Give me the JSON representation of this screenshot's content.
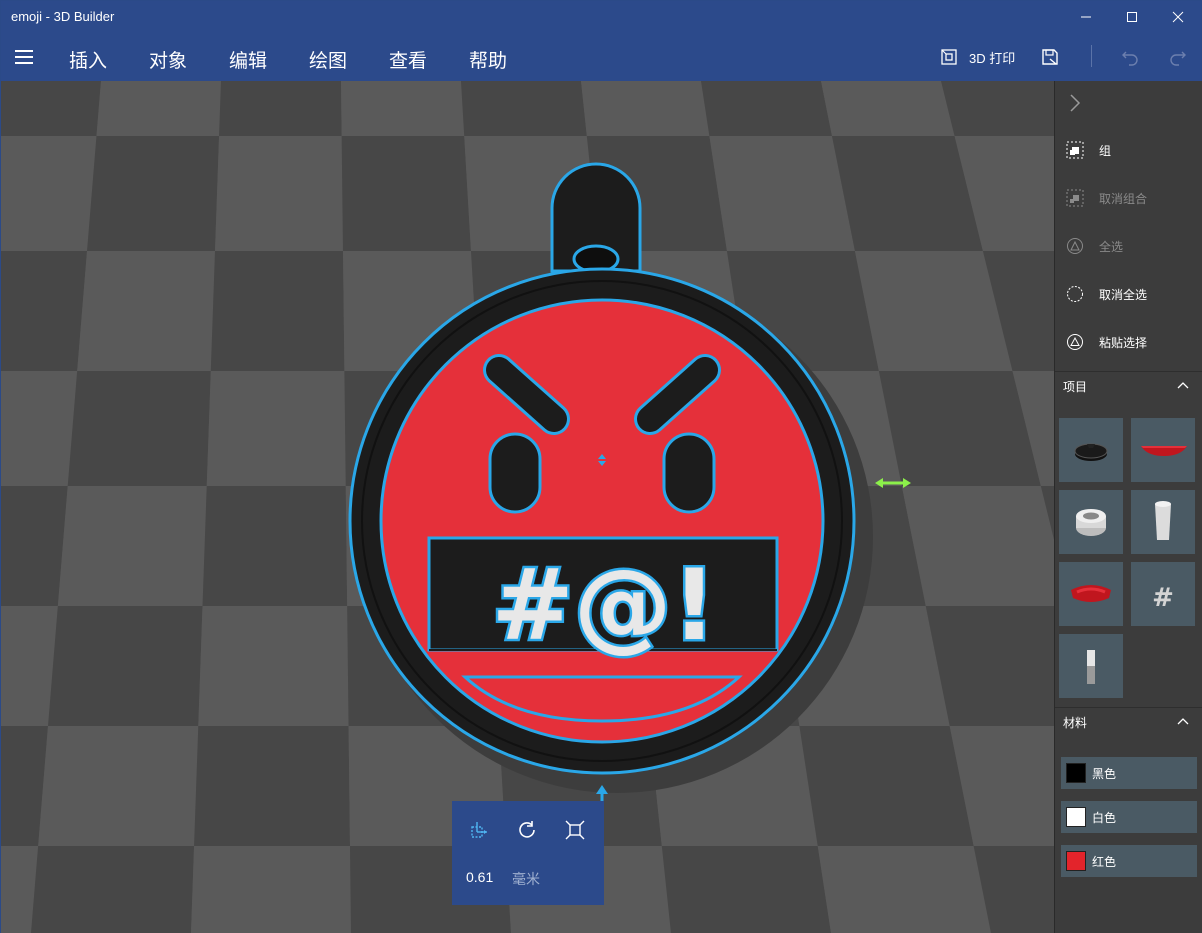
{
  "window": {
    "title": "emoji - 3D Builder"
  },
  "menu": {
    "items": [
      "插入",
      "对象",
      "编辑",
      "绘图",
      "查看",
      "帮助"
    ]
  },
  "toolbar": {
    "print_label": "3D 打印"
  },
  "side": {
    "actions": [
      {
        "label": "组",
        "enabled": true
      },
      {
        "label": "取消组合",
        "enabled": false
      },
      {
        "label": "全选",
        "enabled": false
      },
      {
        "label": "取消全选",
        "enabled": true
      },
      {
        "label": "粘贴选择",
        "enabled": true
      }
    ],
    "items_header": "项目",
    "materials_header": "材料",
    "materials": [
      {
        "label": "黑色",
        "color": "#000000"
      },
      {
        "label": "白色",
        "color": "#ffffff"
      },
      {
        "label": "红色",
        "color": "#e3242b"
      }
    ]
  },
  "model": {
    "text": "#@!",
    "colors": {
      "red": "#e5303a",
      "black": "#1c1c1c",
      "outline": "#2aa7e8",
      "white": "#e8e8e8"
    }
  },
  "floatbar": {
    "value": "0.61",
    "unit": "毫米"
  },
  "colors": {
    "accent": "#2c4a8b",
    "panel": "#3c3c3c",
    "floor_dark": "#474747",
    "floor_light": "#5a5a5a"
  }
}
